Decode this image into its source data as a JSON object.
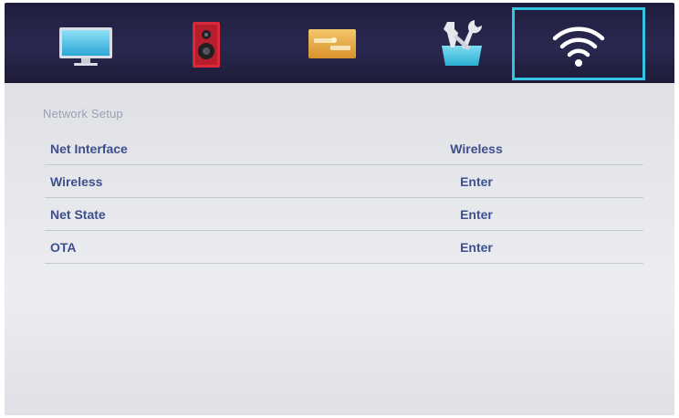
{
  "tabs": [
    {
      "icon": "tv-picture-icon",
      "selected": false
    },
    {
      "icon": "speaker-sound-icon",
      "selected": false
    },
    {
      "icon": "timer-panel-icon",
      "selected": false
    },
    {
      "icon": "tools-setup-icon",
      "selected": false
    },
    {
      "icon": "wifi-network-icon",
      "selected": true
    }
  ],
  "colors": {
    "topbar": "#2a2850",
    "selection_border": "#34c3e3",
    "menu_text": "#3d4f8c",
    "section_title": "#9aa0b6"
  },
  "section_title": "Network Setup",
  "menu": [
    {
      "label": "Net Interface",
      "value": "Wireless"
    },
    {
      "label": "Wireless",
      "value": "Enter"
    },
    {
      "label": "Net State",
      "value": "Enter"
    },
    {
      "label": "OTA",
      "value": "Enter"
    }
  ]
}
